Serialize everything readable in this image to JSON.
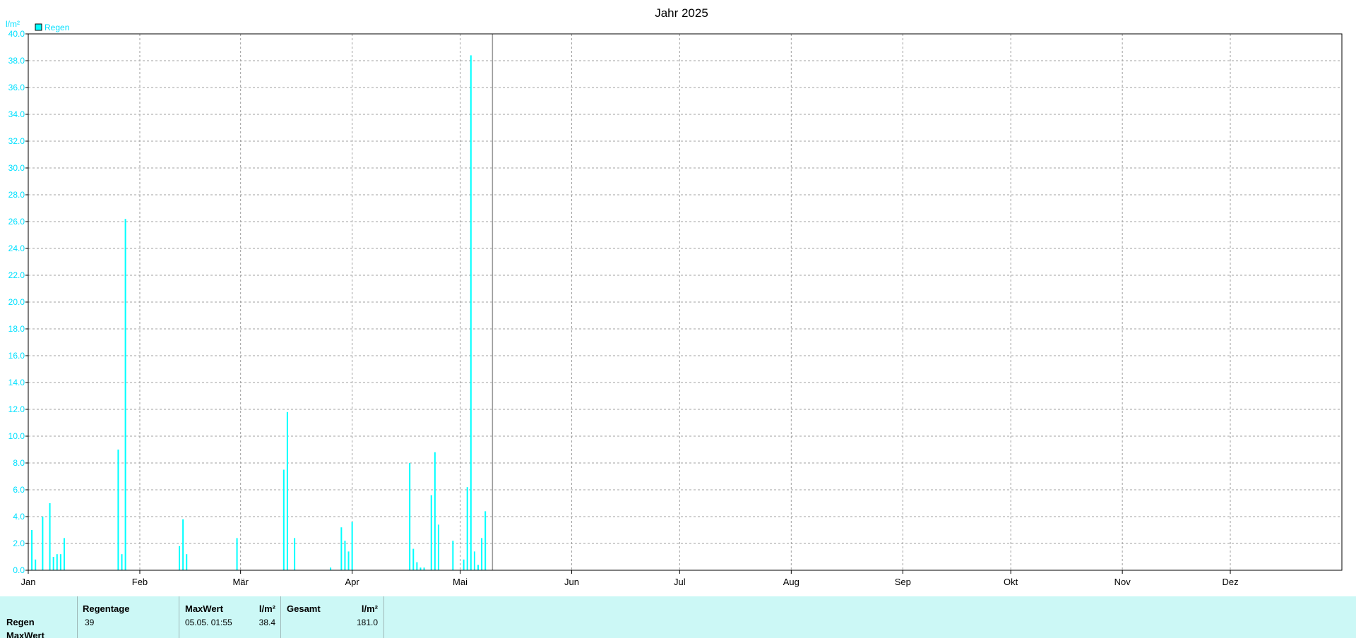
{
  "chart_data": {
    "type": "bar",
    "title": "Jahr 2025",
    "ylabel": "l/m²",
    "ylim": [
      0,
      40
    ],
    "yticks": [
      "0.0",
      "2.0",
      "4.0",
      "6.0",
      "8.0",
      "10.0",
      "12.0",
      "14.0",
      "16.0",
      "18.0",
      "20.0",
      "22.0",
      "24.0",
      "26.0",
      "28.0",
      "30.0",
      "32.0",
      "34.0",
      "36.0",
      "38.0",
      "40.0"
    ],
    "months": [
      "Jan",
      "Feb",
      "Mär",
      "Apr",
      "Mai",
      "Jun",
      "Jul",
      "Aug",
      "Sep",
      "Okt",
      "Nov",
      "Dez"
    ],
    "month_start_days": [
      0,
      31,
      59,
      90,
      120,
      151,
      181,
      212,
      243,
      273,
      304,
      334
    ],
    "days_in_year": 365,
    "current_day": 129,
    "grid": true,
    "legend_position": "top-left",
    "series": [
      {
        "name": "Regen",
        "color": "#00ffff",
        "points": [
          {
            "day": 1,
            "value": 3.0
          },
          {
            "day": 2,
            "value": 0.8
          },
          {
            "day": 4,
            "value": 4.0
          },
          {
            "day": 6,
            "value": 5.0
          },
          {
            "day": 7,
            "value": 1.0
          },
          {
            "day": 8,
            "value": 1.2
          },
          {
            "day": 9,
            "value": 1.2
          },
          {
            "day": 10,
            "value": 2.4
          },
          {
            "day": 25,
            "value": 9.0
          },
          {
            "day": 26,
            "value": 1.2
          },
          {
            "day": 27,
            "value": 26.2
          },
          {
            "day": 42,
            "value": 1.8
          },
          {
            "day": 43,
            "value": 3.8
          },
          {
            "day": 44,
            "value": 1.2
          },
          {
            "day": 58,
            "value": 2.4
          },
          {
            "day": 71,
            "value": 7.5
          },
          {
            "day": 72,
            "value": 11.8
          },
          {
            "day": 74,
            "value": 2.4
          },
          {
            "day": 84,
            "value": 0.2
          },
          {
            "day": 87,
            "value": 3.2
          },
          {
            "day": 88,
            "value": 2.2
          },
          {
            "day": 89,
            "value": 1.4
          },
          {
            "day": 90,
            "value": 3.6
          },
          {
            "day": 106,
            "value": 8.0
          },
          {
            "day": 107,
            "value": 1.6
          },
          {
            "day": 108,
            "value": 0.6
          },
          {
            "day": 109,
            "value": 0.2
          },
          {
            "day": 110,
            "value": 0.2
          },
          {
            "day": 112,
            "value": 5.6
          },
          {
            "day": 113,
            "value": 8.8
          },
          {
            "day": 114,
            "value": 3.4
          },
          {
            "day": 118,
            "value": 2.2
          },
          {
            "day": 121,
            "value": 0.8
          },
          {
            "day": 122,
            "value": 6.2
          },
          {
            "day": 123,
            "value": 38.4
          },
          {
            "day": 124,
            "value": 1.4
          },
          {
            "day": 125,
            "value": 0.4
          },
          {
            "day": 126,
            "value": 2.4
          },
          {
            "day": 127,
            "value": 4.4
          }
        ]
      }
    ]
  },
  "stats": {
    "headers": {
      "regentage": "Regentage",
      "maxwert": "MaxWert",
      "maxwert_unit": "l/m²",
      "gesamt": "Gesamt",
      "gesamt_unit": "l/m²"
    },
    "rows": {
      "regen": "Regen",
      "maxwert": "MaxWert"
    },
    "values": {
      "regentage": "39",
      "maxwert_date": "05.05.  01:55",
      "maxwert_value": "38.4",
      "gesamt": "181.0"
    }
  }
}
